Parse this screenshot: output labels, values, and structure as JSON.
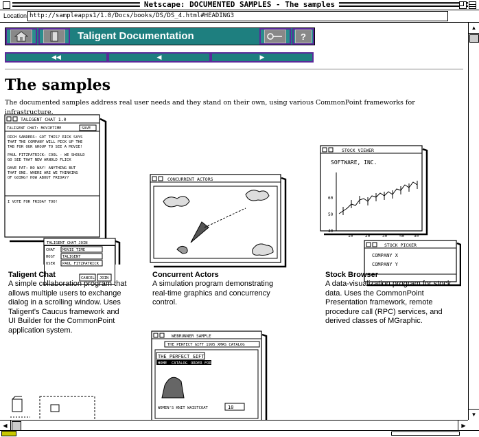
{
  "window": {
    "title": "Netscape: DOCUMENTED SAMPLES - The samples"
  },
  "location": {
    "label": "Location :",
    "url": "http://sampleapps1/1.0/Docs/books/DS/DS_4.html#HEADING3"
  },
  "navbar": {
    "title": "Taligent Documentation",
    "help_label": "?",
    "prev_label": "◀◀",
    "back_label": "◀",
    "next_label": "▶"
  },
  "page": {
    "heading": "The samples",
    "intro": "The documented samples address real user needs and they stand on their own, using various CommonPoint frameworks for infrastructure."
  },
  "samples": [
    {
      "name": "Taligent Chat",
      "description": "A simple collaboration program that allows multiple users to exchange dialog in a scrolling window. Uses Taligent's Caucus framework and UI Builder for the CommonPoint application system."
    },
    {
      "name": "Concurrent Actors",
      "description": "A simulation program demonstrating real-time graphics and concurrency control."
    },
    {
      "name": "Stock Browser",
      "description": "A data-visualization program for stock data. Uses the CommonPoint Presentation framework, remote procedure call (RPC) services, and derived classes of MGraphic."
    }
  ],
  "sketches": {
    "chat": {
      "window_title": "TALIGENT CHAT 1.0",
      "subtitle": "TALIGENT CHAT: MOVIETIME",
      "save": "SAVE",
      "lines": [
        "RICH SANDERS: GOT THIS? RICK SAYS",
        "THAT THE COMPANY WILL PICK UP THE",
        "TAB FOR OUR GROUP TO SEE A MOVIE!",
        "PAUL FITZPATRICK: COOL - WE SHOULD",
        "GO SEE THAT NEW ARNOLD FLICK",
        "DAVE PAT: NO WAY! ANYTHING BUT",
        "THAT ONE. WHERE ARE WE THINKING",
        "OF GOING? HOW ABOUT FRIDAY?",
        "I VOTE FOR FRIDAY TOO!"
      ],
      "join_title": "TALIGENT CHAT JOIN",
      "join_chat": "CHAT",
      "join_chat_val": "MOVIE TIME",
      "join_host": "HOST",
      "join_host_val": "TALIGENT",
      "join_user": "USER",
      "join_user_val": "PAUL FITZPATRICK",
      "cancel": "CANCEL",
      "join": "JOIN"
    },
    "actors": {
      "window_title": "CONCURRENT ACTORS"
    },
    "stock": {
      "window_title": "STOCK VIEWER",
      "company": "SOFTWARE, INC.",
      "y_ticks": [
        "60",
        "50",
        "40"
      ],
      "x_ticks": [
        "10",
        "20",
        "30",
        "40",
        "50"
      ],
      "picker_title": "STOCK PICKER",
      "picker_items": [
        "COMPANY X",
        "COMPANY Y"
      ]
    },
    "webrunner": {
      "window_title": "WEBRUNNER SAMPLE",
      "url": "THE PERFECT GIFT 1995 XMAS CATALOG",
      "banner": "THE PERFECT GIFT",
      "tabs": [
        "HOME",
        "CATALOG",
        "ORDER FORM"
      ],
      "item": "WOMEN'S KNIT WAISTCOAT",
      "qty": "10"
    }
  }
}
